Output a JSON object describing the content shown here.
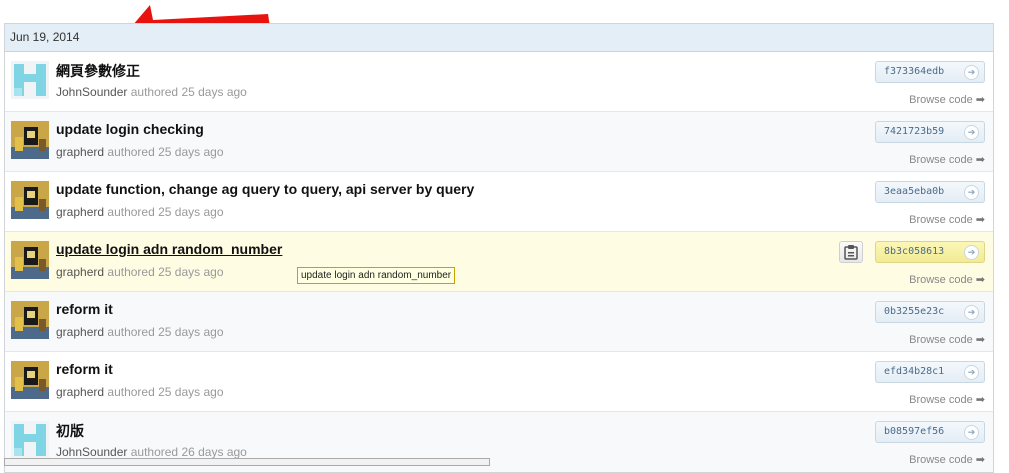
{
  "date_header": "Jun 19, 2014",
  "tooltip": "update login adn random_number",
  "commits": [
    {
      "title": "網頁參數修正",
      "author": "JohnSounder",
      "action": "authored",
      "time": "25 days ago",
      "sha": "f373364edb",
      "browse": "Browse code",
      "avatar": "identicon"
    },
    {
      "title": "update login checking",
      "author": "grapherd",
      "action": "authored",
      "time": "25 days ago",
      "sha": "7421723b59",
      "browse": "Browse code",
      "avatar": "photo"
    },
    {
      "title": "update function, change ag query to query, api server by query",
      "author": "grapherd",
      "action": "authored",
      "time": "25 days ago",
      "sha": "3eaa5eba0b",
      "browse": "Browse code",
      "avatar": "photo"
    },
    {
      "title": "update login adn random_number",
      "author": "grapherd",
      "action": "authored",
      "time": "25 days ago",
      "sha": "8b3c058613",
      "browse": "Browse code",
      "avatar": "photo"
    },
    {
      "title": "reform it",
      "author": "grapherd",
      "action": "authored",
      "time": "25 days ago",
      "sha": "0b3255e23c",
      "browse": "Browse code",
      "avatar": "photo"
    },
    {
      "title": "reform it",
      "author": "grapherd",
      "action": "authored",
      "time": "25 days ago",
      "sha": "efd34b28c1",
      "browse": "Browse code",
      "avatar": "photo"
    },
    {
      "title": "初版",
      "author": "JohnSounder",
      "action": "authored",
      "time": "26 days ago",
      "sha": "b08597ef56",
      "browse": "Browse code",
      "avatar": "identicon"
    }
  ],
  "colors": {
    "accent": "#e4eef6",
    "highlight_row": "#fefce3",
    "arrow": "#e8130f"
  }
}
